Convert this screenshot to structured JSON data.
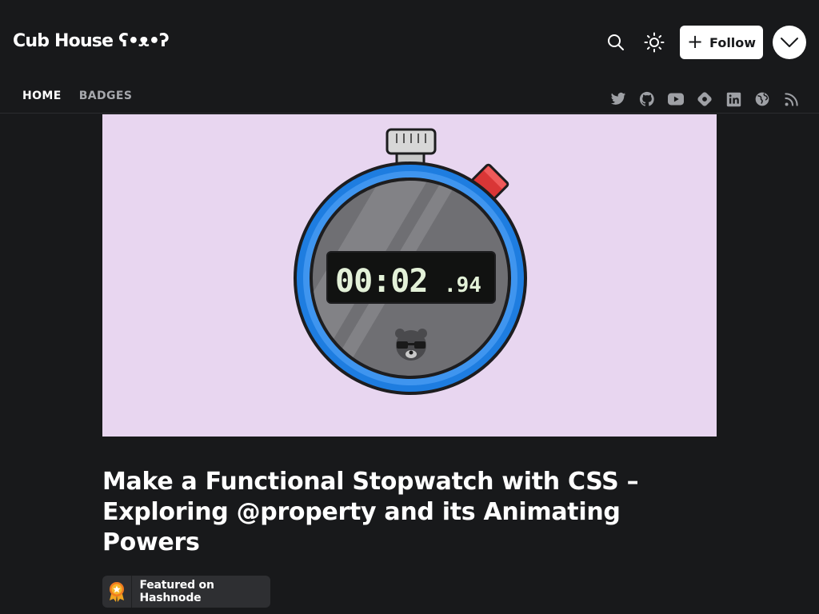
{
  "header": {
    "brand": "Cub House ʕ•ᴥ•ʔ",
    "follow_label": "Follow",
    "icons": [
      "search-icon",
      "sun-icon",
      "chevron-down-icon"
    ]
  },
  "nav": {
    "items": [
      {
        "label": "HOME",
        "active": true
      },
      {
        "label": "BADGES",
        "active": false
      }
    ]
  },
  "socials": [
    "twitter-icon",
    "github-icon",
    "youtube-icon",
    "hashnode-icon",
    "linkedin-icon",
    "globe-icon",
    "rss-icon"
  ],
  "cover": {
    "timer_main": "00:02",
    "timer_fraction": ".94",
    "background": "#e8d6f0"
  },
  "post": {
    "title": "Make a Functional Stopwatch with CSS – Exploring @property and its Animating Powers",
    "featured_label": "Featured on Hashnode"
  },
  "colors": {
    "background": "#18191b",
    "stopwatch_ring": "#1e7de0",
    "stopwatch_button": "#d93636"
  }
}
